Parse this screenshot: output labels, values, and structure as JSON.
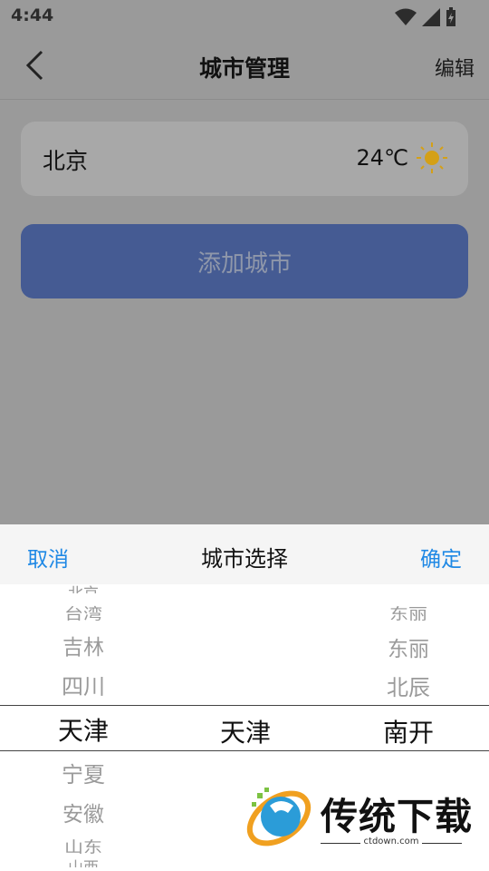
{
  "status": {
    "time": "4:44"
  },
  "nav": {
    "title": "城市管理",
    "edit": "编辑"
  },
  "city": {
    "name": "北京",
    "temp": "24℃",
    "weather_icon": "sun-icon"
  },
  "add_button": "添加城市",
  "picker": {
    "cancel": "取消",
    "title": "城市选择",
    "confirm": "确定",
    "province_column": [
      "北京",
      "台湾",
      "吉林",
      "四川",
      "天津",
      "宁夏",
      "安徽",
      "山东",
      "山西"
    ],
    "city_column": [
      "天津"
    ],
    "district_column": [
      "东丽",
      "东丽",
      "北辰",
      "南开"
    ]
  },
  "watermark": {
    "name": "传统下载",
    "url": "ctdown.com"
  },
  "colors": {
    "accent": "#1e88e5",
    "add_button_bg": "#455b93",
    "sun": "#d4a017"
  }
}
